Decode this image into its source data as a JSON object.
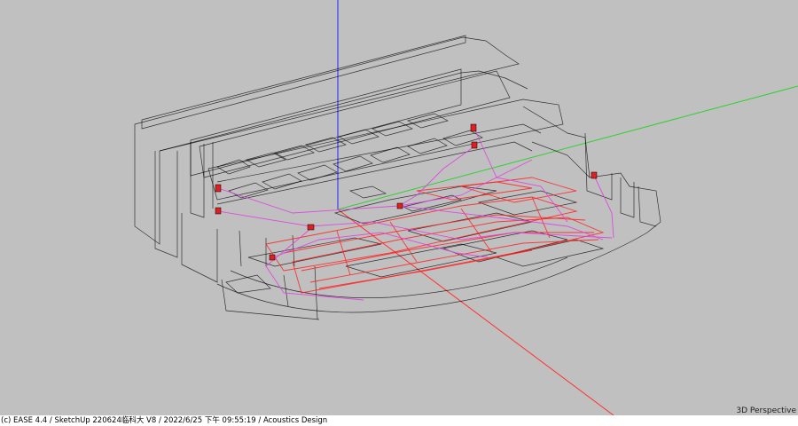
{
  "viewport": {
    "mode_label": "3D Perspective",
    "axis_colors": {
      "x": "#ff3030",
      "y": "#30d030",
      "z": "#2020ff"
    },
    "wire_color": "#000000",
    "ray_color": "#e040e0",
    "seat_color": "#ff2020",
    "source_icon": "loudspeaker-icon"
  },
  "status_bar": {
    "text": "(c) EASE 4.4  / SketchUp 220624临科大 V8  / 2022/6/25 下午 09:55:19 / Acoustics Design"
  }
}
